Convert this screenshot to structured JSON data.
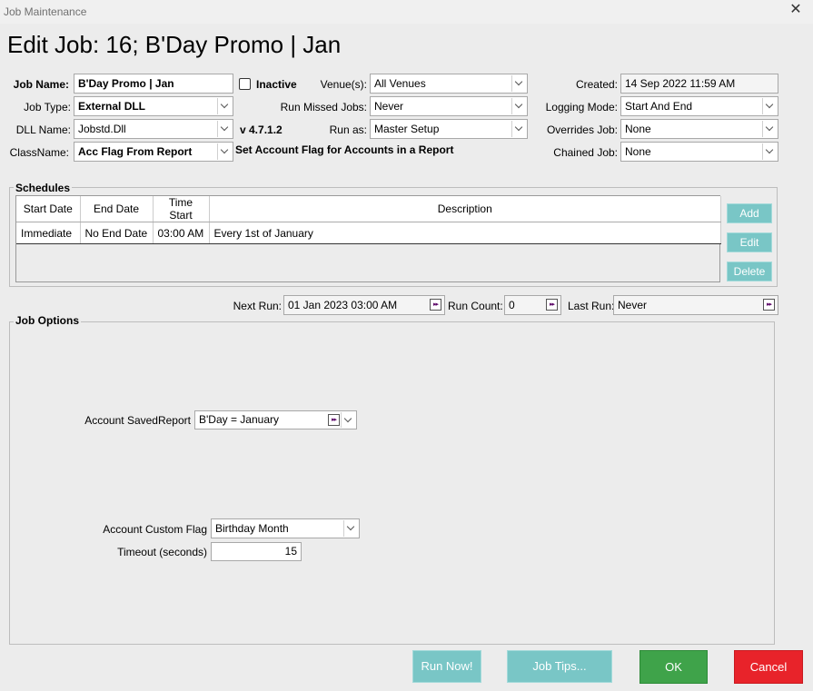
{
  "window": {
    "title": "Job Maintenance",
    "close_glyph": "✕"
  },
  "heading": "Edit Job: 16; B'Day Promo | Jan",
  "form": {
    "job_name": {
      "label": "Job Name:",
      "value": "B'Day Promo | Jan"
    },
    "inactive": {
      "label": "Inactive",
      "checked": false
    },
    "job_type": {
      "label": "Job Type:",
      "value": "External DLL"
    },
    "dll_name": {
      "label": "DLL Name:",
      "value": "Jobstd.Dll"
    },
    "version": "v 4.7.1.2",
    "class_name": {
      "label": "ClassName:",
      "value": "Acc Flag From Report"
    },
    "class_description": "Set Account Flag for Accounts in a Report",
    "venues": {
      "label": "Venue(s):",
      "value": "All Venues"
    },
    "run_missed_jobs": {
      "label": "Run Missed Jobs:",
      "value": "Never"
    },
    "run_as": {
      "label": "Run as:",
      "value": "Master Setup"
    },
    "created": {
      "label": "Created:",
      "value": "14 Sep 2022 11:59 AM"
    },
    "logging_mode": {
      "label": "Logging Mode:",
      "value": "Start And End"
    },
    "overrides_job": {
      "label": "Overrides Job:",
      "value": "None"
    },
    "chained_job": {
      "label": "Chained Job:",
      "value": "None"
    }
  },
  "schedules": {
    "title": "Schedules",
    "columns": [
      "Start Date",
      "End Date",
      "Time Start",
      "Description"
    ],
    "rows": [
      [
        "Immediate",
        "No End Date",
        "03:00 AM",
        "Every 1st of January"
      ]
    ],
    "buttons": {
      "add": "Add",
      "edit": "Edit",
      "delete": "Delete"
    }
  },
  "run_info": {
    "next_run": {
      "label": "Next Run:",
      "value": "01 Jan 2023 03:00 AM"
    },
    "run_count": {
      "label": "Run Count:",
      "value": "0"
    },
    "last_run": {
      "label": "Last Run:",
      "value": "Never"
    },
    "ff_glyph": "▸▸"
  },
  "job_options": {
    "title": "Job Options",
    "saved_report": {
      "label": "Account SavedReport",
      "value": "B'Day = January"
    },
    "custom_flag": {
      "label": "Account Custom Flag",
      "value": "Birthday Month"
    },
    "timeout": {
      "label": "Timeout (seconds)",
      "value": "15"
    }
  },
  "footer": {
    "run_now": "Run Now!",
    "job_tips": "Job Tips...",
    "ok": "OK",
    "cancel": "Cancel"
  },
  "colors": {
    "teal": "#79c6c6",
    "ok_green": "#3fa34a",
    "cancel_red": "#e8232a"
  }
}
